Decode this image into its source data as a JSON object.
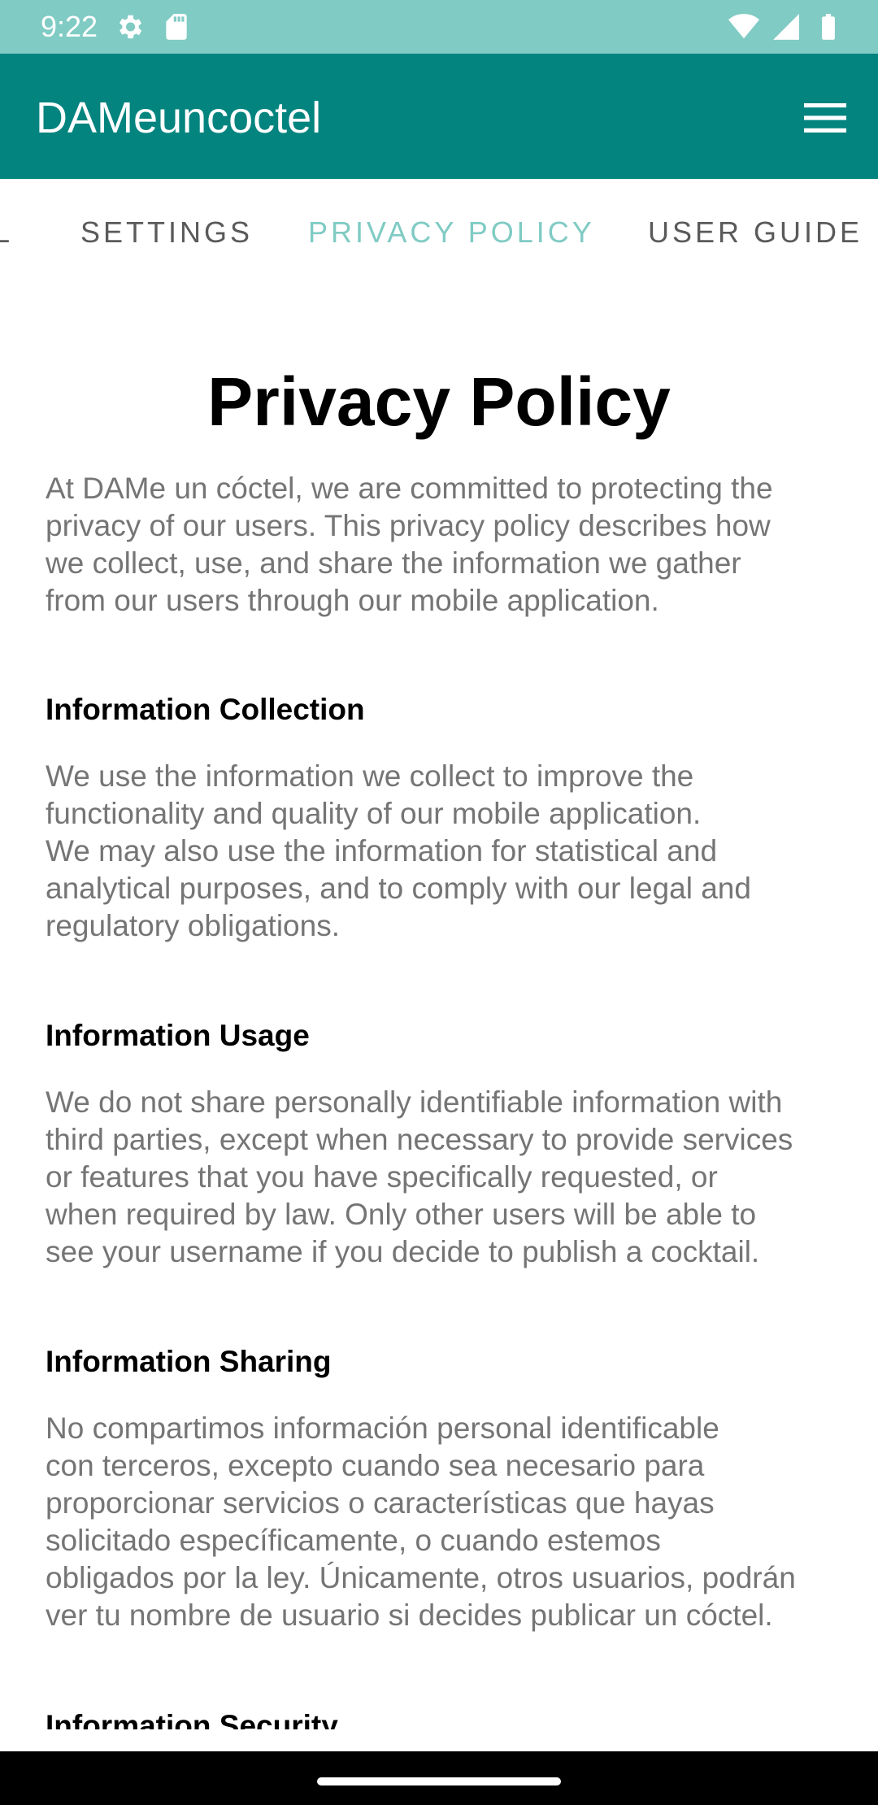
{
  "status_bar": {
    "time": "9:22",
    "left_icons": [
      "settings-icon",
      "sd-card-icon"
    ],
    "right_icons": [
      "wifi-icon",
      "signal-icon",
      "battery-icon"
    ]
  },
  "app_bar": {
    "title": "DAMeuncoctel",
    "menu_icon": "menu-icon"
  },
  "tabs": [
    {
      "label": "IL",
      "active": false
    },
    {
      "label": "SETTINGS",
      "active": false
    },
    {
      "label": "PRIVACY POLICY",
      "active": true
    },
    {
      "label": "USER GUIDE",
      "active": false
    }
  ],
  "content": {
    "title": "Privacy Policy",
    "intro": "At DAMe un cóctel, we are committed to protecting the\nprivacy of our users. This privacy policy describes how\nwe collect, use, and share the information we gather\nfrom our users through our mobile application.",
    "sections": [
      {
        "heading": "Information Collection",
        "body": "We use the information we collect to improve the\nfunctionality and quality of our mobile application.\nWe may also use the information for statistical and\nanalytical purposes, and to comply with our legal and\nregulatory obligations."
      },
      {
        "heading": "Information Usage",
        "body": "We do not share personally identifiable information with\nthird parties, except when necessary to provide services\nor features that you have specifically requested, or\nwhen required by law. Only other users will be able to\nsee your username if you decide to publish a cocktail."
      },
      {
        "heading": "Information Sharing",
        "body": "No compartimos información personal identificable\ncon terceros, excepto cuando sea necesario para\nproporcionar servicios o características que hayas\nsolicitado específicamente, o cuando estemos\nobligados por la ley. Únicamente, otros usuarios, podrán\nver tu nombre de usuario si decides publicar un cóctel."
      },
      {
        "heading": "Information Security",
        "body": ""
      }
    ]
  },
  "colors": {
    "status_bar": "#80cbc4",
    "app_bar": "#03847f",
    "tab_active": "#80cbc4",
    "tab_inactive": "#5a5a5a",
    "body_text": "#757575",
    "heading_text": "#000000"
  }
}
